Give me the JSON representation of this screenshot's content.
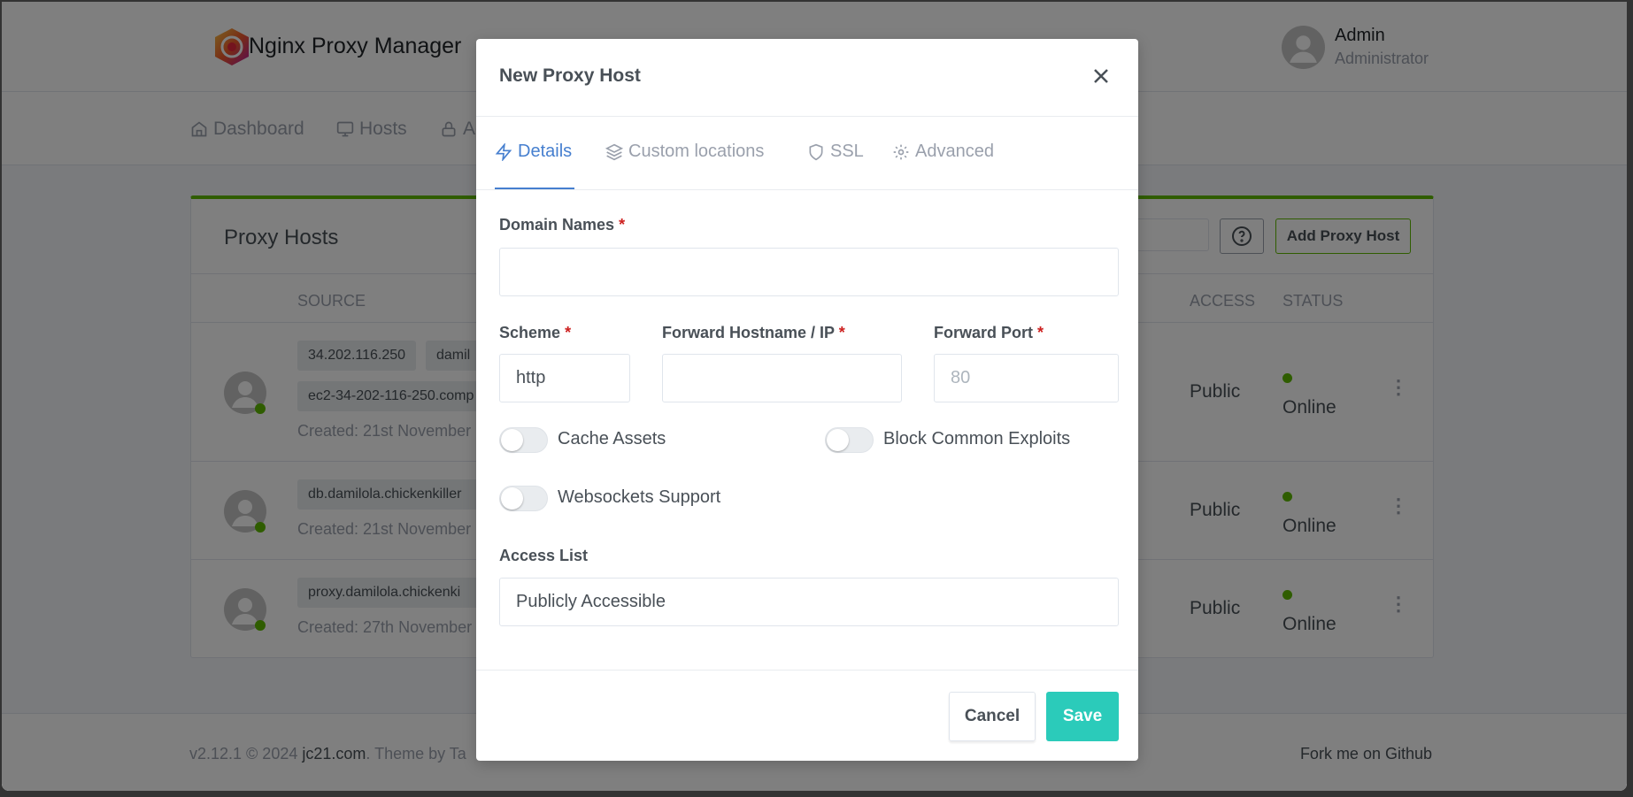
{
  "app": {
    "title": "Nginx Proxy Manager",
    "logo": "nginx-proxy-manager-logo"
  },
  "user": {
    "name": "Admin",
    "role": "Administrator"
  },
  "nav": [
    {
      "label": "Dashboard",
      "icon": "home-icon"
    },
    {
      "label": "Hosts",
      "icon": "monitor-icon"
    },
    {
      "label": "Access",
      "icon": "lock-icon"
    }
  ],
  "card": {
    "title": "Proxy Hosts",
    "add_label": "Add Proxy Host",
    "help_icon": "help-circle-icon",
    "columns": {
      "source": "SOURCE",
      "access": "ACCESS",
      "status": "STATUS"
    },
    "rows": [
      {
        "tags": [
          "34.202.116.250",
          "damil",
          "ec2-34-202-116-250.comp"
        ],
        "created": "Created: 21st November",
        "access": "Public",
        "status": "Online"
      },
      {
        "tags": [
          "db.damilola.chickenkiller"
        ],
        "created": "Created: 21st November",
        "access": "Public",
        "status": "Online"
      },
      {
        "tags": [
          "proxy.damilola.chickenki"
        ],
        "created": "Created: 27th November",
        "access": "Public",
        "status": "Online"
      }
    ]
  },
  "footer": {
    "left": "v2.12.1 © 2024 ",
    "link": "jc21.com",
    "theme": ". Theme by Ta",
    "right": "Fork me on Github"
  },
  "modal": {
    "title": "New Proxy Host",
    "tabs": [
      {
        "label": "Details",
        "icon": "zap-icon"
      },
      {
        "label": "Custom locations",
        "icon": "layers-icon"
      },
      {
        "label": "SSL",
        "icon": "shield-icon"
      },
      {
        "label": "Advanced",
        "icon": "gear-icon"
      }
    ],
    "active_tab": "Details",
    "domain_label": "Domain Names",
    "domain_value": "",
    "scheme_label": "Scheme",
    "scheme_value": "http",
    "host_label": "Forward Hostname / IP",
    "host_value": "",
    "port_label": "Forward Port",
    "port_placeholder": "80",
    "required_mark": "*",
    "toggles": [
      {
        "label": "Cache Assets",
        "on": false
      },
      {
        "label": "Block Common Exploits",
        "on": false
      },
      {
        "label": "Websockets Support",
        "on": false
      }
    ],
    "access_label": "Access List",
    "access_value": "Publicly Accessible",
    "cancel": "Cancel",
    "save": "Save"
  },
  "colors": {
    "accent": "#467fcf",
    "green": "#5eba00",
    "save": "#2bcbba",
    "required": "#cd201f"
  }
}
